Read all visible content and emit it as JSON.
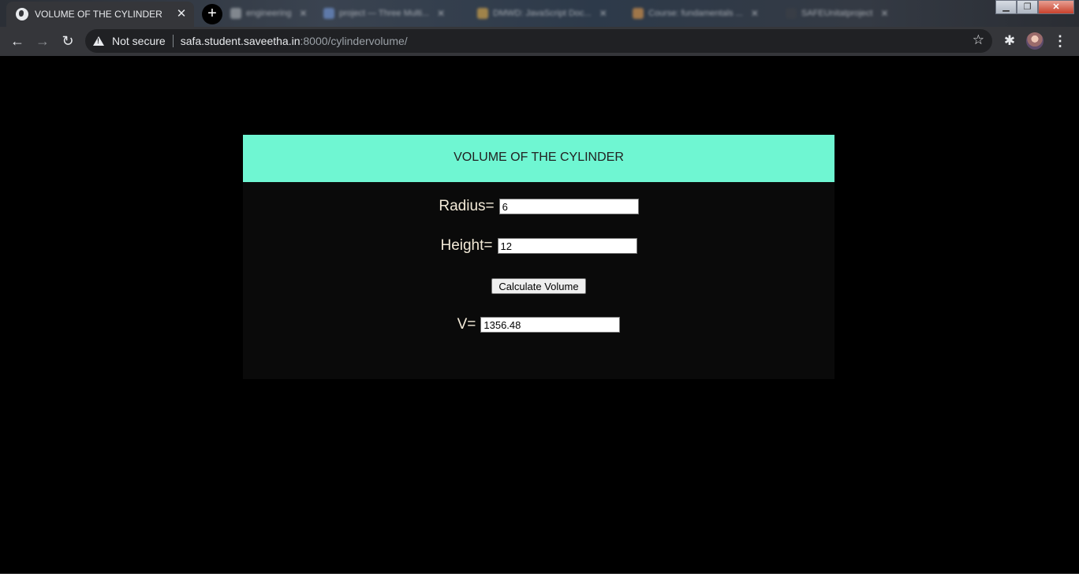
{
  "browser": {
    "active_tab": {
      "title": "VOLUME OF THE CYLINDER",
      "close_glyph": "✕"
    },
    "new_tab_glyph": "+",
    "background_tabs": [
      {
        "title": "engineering",
        "favicon_color": "#9aa0a6"
      },
      {
        "title": "project — Three Multi...",
        "favicon_color": "#6b8cc7"
      },
      {
        "title": "DMWD: JavaScript Doc...",
        "favicon_color": "#c59b4a"
      },
      {
        "title": "Course: fundamentals ...",
        "favicon_color": "#c58a4a"
      },
      {
        "title": "SAFEUnitatproject",
        "favicon_color": "#3a3f46"
      }
    ],
    "window_buttons": {
      "minimize": "▁",
      "maximize": "❐",
      "close": "✕"
    },
    "nav": {
      "back": "←",
      "forward": "→",
      "reload": "↻"
    },
    "omnibox": {
      "security_label": "Not secure",
      "url_host": "safa.student.saveetha.in",
      "url_rest": ":8000/cylindervolume/"
    },
    "icons": {
      "star": "star-icon",
      "extensions": "puzzle-icon",
      "profile": "avatar",
      "menu": "kebab-menu-icon"
    }
  },
  "page": {
    "header": "VOLUME OF THE CYLINDER",
    "radius": {
      "label": "Radius=",
      "value": "6"
    },
    "height": {
      "label": "Height=",
      "value": "12"
    },
    "button": {
      "label": "Calculate Volume"
    },
    "volume": {
      "label": "V=",
      "value": "1356.48"
    }
  },
  "colors": {
    "header_bg": "#6ff6d2",
    "card_bg": "#0a0a0a",
    "page_bg": "#000000",
    "label_text": "#f3ead8"
  }
}
